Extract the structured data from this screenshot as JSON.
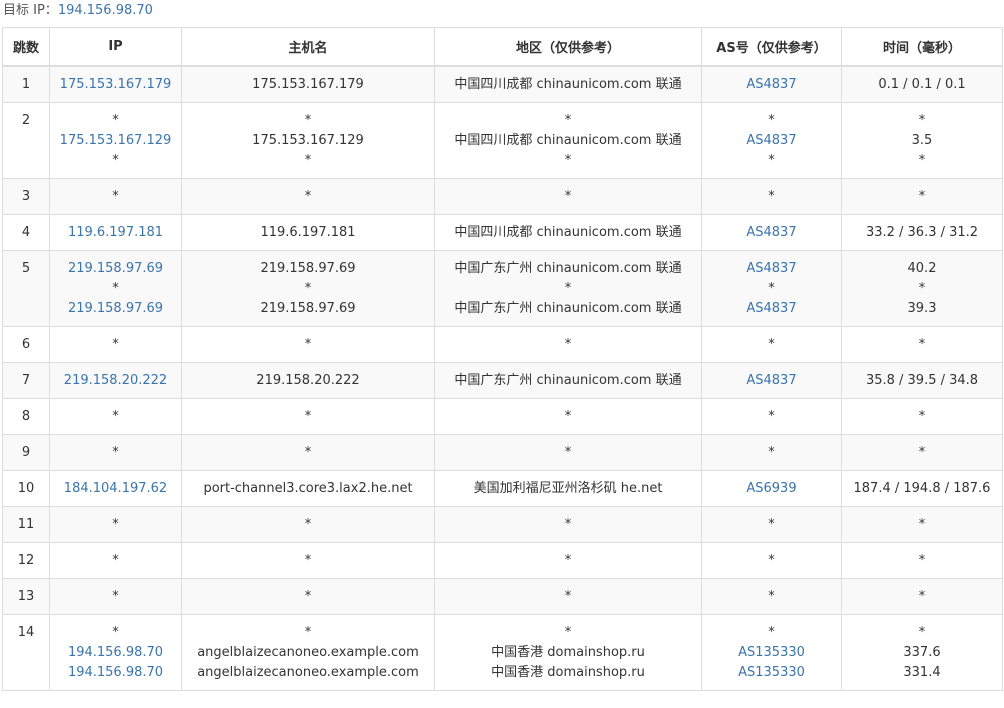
{
  "target": {
    "label": "目标 IP：",
    "ip": "194.156.98.70"
  },
  "table": {
    "columns": [
      "跳数",
      "IP",
      "主机名",
      "地区（仅供参考）",
      "AS号（仅供参考）",
      "时间（毫秒）"
    ],
    "rows": [
      {
        "hop": "1",
        "ip": [
          "175.153.167.179"
        ],
        "host": [
          "175.153.167.179"
        ],
        "region": [
          "中国四川成都 chinaunicom.com 联通"
        ],
        "as": [
          "AS4837"
        ],
        "time": [
          "0.1 / 0.1 / 0.1"
        ]
      },
      {
        "hop": "2",
        "ip": [
          "*",
          "175.153.167.129",
          "*"
        ],
        "host": [
          "*",
          "175.153.167.129",
          "*"
        ],
        "region": [
          "*",
          "中国四川成都 chinaunicom.com 联通",
          "*"
        ],
        "as": [
          "*",
          "AS4837",
          "*"
        ],
        "time": [
          "*",
          "3.5",
          "*"
        ]
      },
      {
        "hop": "3",
        "ip": [
          "*"
        ],
        "host": [
          "*"
        ],
        "region": [
          "*"
        ],
        "as": [
          "*"
        ],
        "time": [
          "*"
        ]
      },
      {
        "hop": "4",
        "ip": [
          "119.6.197.181"
        ],
        "host": [
          "119.6.197.181"
        ],
        "region": [
          "中国四川成都 chinaunicom.com 联通"
        ],
        "as": [
          "AS4837"
        ],
        "time": [
          "33.2 / 36.3 / 31.2"
        ]
      },
      {
        "hop": "5",
        "ip": [
          "219.158.97.69",
          "*",
          "219.158.97.69"
        ],
        "host": [
          "219.158.97.69",
          "*",
          "219.158.97.69"
        ],
        "region": [
          "中国广东广州 chinaunicom.com 联通",
          "*",
          "中国广东广州 chinaunicom.com 联通"
        ],
        "as": [
          "AS4837",
          "*",
          "AS4837"
        ],
        "time": [
          "40.2",
          "*",
          "39.3"
        ]
      },
      {
        "hop": "6",
        "ip": [
          "*"
        ],
        "host": [
          "*"
        ],
        "region": [
          "*"
        ],
        "as": [
          "*"
        ],
        "time": [
          "*"
        ]
      },
      {
        "hop": "7",
        "ip": [
          "219.158.20.222"
        ],
        "host": [
          "219.158.20.222"
        ],
        "region": [
          "中国广东广州 chinaunicom.com 联通"
        ],
        "as": [
          "AS4837"
        ],
        "time": [
          "35.8 / 39.5 / 34.8"
        ]
      },
      {
        "hop": "8",
        "ip": [
          "*"
        ],
        "host": [
          "*"
        ],
        "region": [
          "*"
        ],
        "as": [
          "*"
        ],
        "time": [
          "*"
        ]
      },
      {
        "hop": "9",
        "ip": [
          "*"
        ],
        "host": [
          "*"
        ],
        "region": [
          "*"
        ],
        "as": [
          "*"
        ],
        "time": [
          "*"
        ]
      },
      {
        "hop": "10",
        "ip": [
          "184.104.197.62"
        ],
        "host": [
          "port-channel3.core3.lax2.he.net"
        ],
        "region": [
          "美国加利福尼亚州洛杉矶 he.net"
        ],
        "as": [
          "AS6939"
        ],
        "time": [
          "187.4 / 194.8 / 187.6"
        ]
      },
      {
        "hop": "11",
        "ip": [
          "*"
        ],
        "host": [
          "*"
        ],
        "region": [
          "*"
        ],
        "as": [
          "*"
        ],
        "time": [
          "*"
        ]
      },
      {
        "hop": "12",
        "ip": [
          "*"
        ],
        "host": [
          "*"
        ],
        "region": [
          "*"
        ],
        "as": [
          "*"
        ],
        "time": [
          "*"
        ]
      },
      {
        "hop": "13",
        "ip": [
          "*"
        ],
        "host": [
          "*"
        ],
        "region": [
          "*"
        ],
        "as": [
          "*"
        ],
        "time": [
          "*"
        ]
      },
      {
        "hop": "14",
        "ip": [
          "*",
          "194.156.98.70",
          "194.156.98.70"
        ],
        "host": [
          "*",
          "angelblaizecanoneo.example.com",
          "angelblaizecanoneo.example.com"
        ],
        "region": [
          "*",
          "中国香港 domainshop.ru",
          "中国香港 domainshop.ru"
        ],
        "as": [
          "*",
          "AS135330",
          "AS135330"
        ],
        "time": [
          "*",
          "337.6",
          "331.4"
        ]
      }
    ]
  },
  "colors": {
    "link": "#3a74ac",
    "text": "#333333",
    "border": "#dddddd",
    "stripe": "#f9f9f9"
  }
}
